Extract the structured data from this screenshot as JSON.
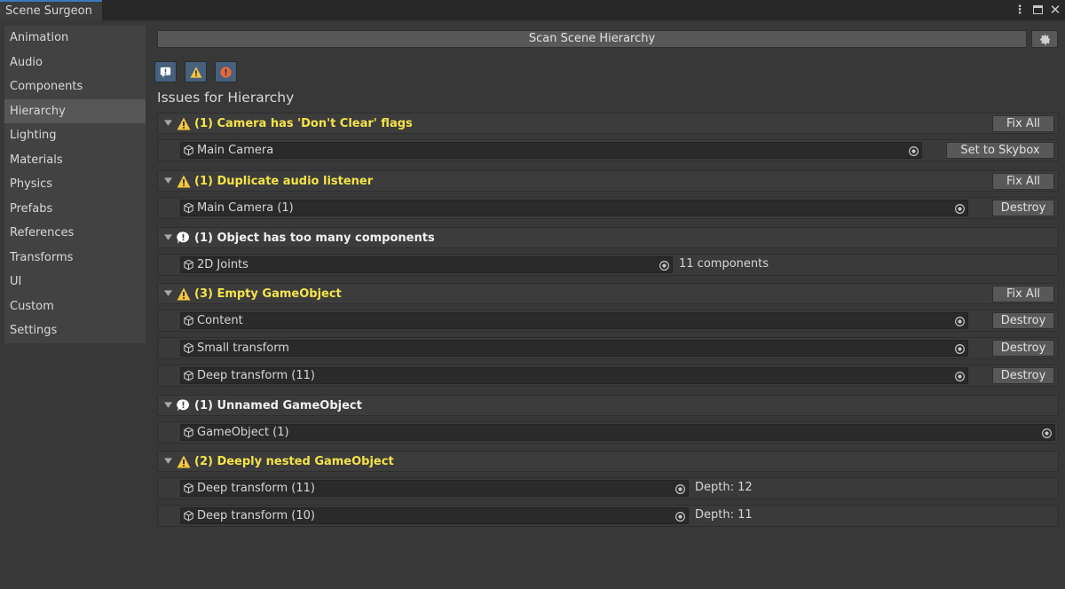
{
  "window": {
    "title": "Scene Surgeon"
  },
  "sidebar": {
    "items": [
      {
        "label": "Animation"
      },
      {
        "label": "Audio"
      },
      {
        "label": "Components"
      },
      {
        "label": "Hierarchy",
        "active": true
      },
      {
        "label": "Lighting"
      },
      {
        "label": "Materials"
      },
      {
        "label": "Physics"
      },
      {
        "label": "Prefabs"
      },
      {
        "label": "References"
      },
      {
        "label": "Transforms"
      },
      {
        "label": "UI"
      },
      {
        "label": "Custom"
      },
      {
        "label": "Settings"
      }
    ]
  },
  "toolbar": {
    "scan_label": "Scan Scene Hierarchy"
  },
  "filters": [
    "info-filter-icon",
    "warning-filter-icon",
    "error-filter-icon"
  ],
  "issues_title": "Issues for Hierarchy",
  "colors": {
    "warning": "#f5e34a",
    "info": "#f0f0f0",
    "accent": "#3a79bb"
  },
  "groups": [
    {
      "severity": "warning",
      "title": "(1) Camera has 'Don't Clear' flags",
      "fix_all": "Fix All",
      "rows": [
        {
          "object": "Main Camera",
          "action": "Set to Skybox"
        }
      ]
    },
    {
      "severity": "warning",
      "title": "(1) Duplicate audio listener",
      "fix_all": "Fix All",
      "rows": [
        {
          "object": "Main Camera (1)",
          "action": "Destroy"
        }
      ]
    },
    {
      "severity": "info",
      "title": "(1) Object has too many components",
      "rows": [
        {
          "object": "2D Joints",
          "note": "11 components"
        }
      ]
    },
    {
      "severity": "warning",
      "title": "(3) Empty GameObject",
      "fix_all": "Fix All",
      "rows": [
        {
          "object": "Content",
          "action": "Destroy"
        },
        {
          "object": "Small transform",
          "action": "Destroy"
        },
        {
          "object": "Deep transform (11)",
          "action": "Destroy"
        }
      ]
    },
    {
      "severity": "info",
      "title": "(1) Unnamed GameObject",
      "rows": [
        {
          "object": "GameObject (1)"
        }
      ]
    },
    {
      "severity": "warning",
      "title": "(2) Deeply nested GameObject",
      "rows": [
        {
          "object": "Deep transform (11)",
          "note": "Depth: 12"
        },
        {
          "object": "Deep transform (10)",
          "note": "Depth: 11"
        }
      ]
    }
  ]
}
